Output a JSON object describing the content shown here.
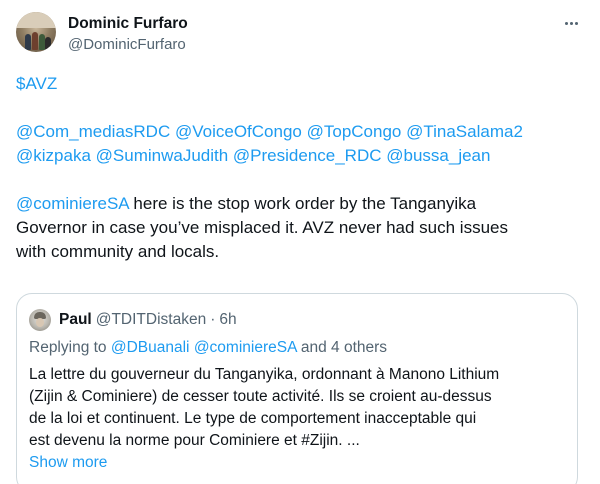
{
  "author": {
    "display_name": "Dominic Furfaro",
    "handle": "@DominicFurfaro"
  },
  "tweet": {
    "cashtag": "$AVZ",
    "mentions_line1": [
      "@Com_mediasRDC",
      "@VoiceOfCongo",
      "@TopCongo",
      "@TinaSalama2"
    ],
    "mentions_line2": [
      "@kizpaka",
      "@SuminwaJudith",
      "@Presidence_RDC",
      "@bussa_jean"
    ],
    "reply_mention": "@cominiereSA",
    "text_line1": " here is the stop work order by the Tanganyika",
    "text_line2": "Governor in case you’ve misplaced it. AVZ never had such issues",
    "text_line3": "with community and locals."
  },
  "quote": {
    "display_name": "Paul",
    "handle": "@TDITDistaken",
    "separator": "·",
    "time": "6h",
    "replying_prefix": "Replying to ",
    "replying_mentions": [
      "@DBuanali",
      "@cominiereSA"
    ],
    "replying_suffix": "and 4 others",
    "text_lines": [
      "La lettre du gouverneur du Tanganyika, ordonnant à Manono Lithium",
      "(Zijin & Cominiere) de cesser toute activité.  Ils se croient au-dessus",
      "de la loi et continuent.  Le type de comportement inacceptable qui",
      "est devenu la norme pour Cominiere et #Zijin. ..."
    ],
    "show_more": "Show more"
  },
  "colors": {
    "link": "#1d9bf0",
    "text": "#0f1419",
    "secondary": "#536471",
    "border": "#cfd9de"
  },
  "icons": {
    "more": "more-dots-icon"
  }
}
